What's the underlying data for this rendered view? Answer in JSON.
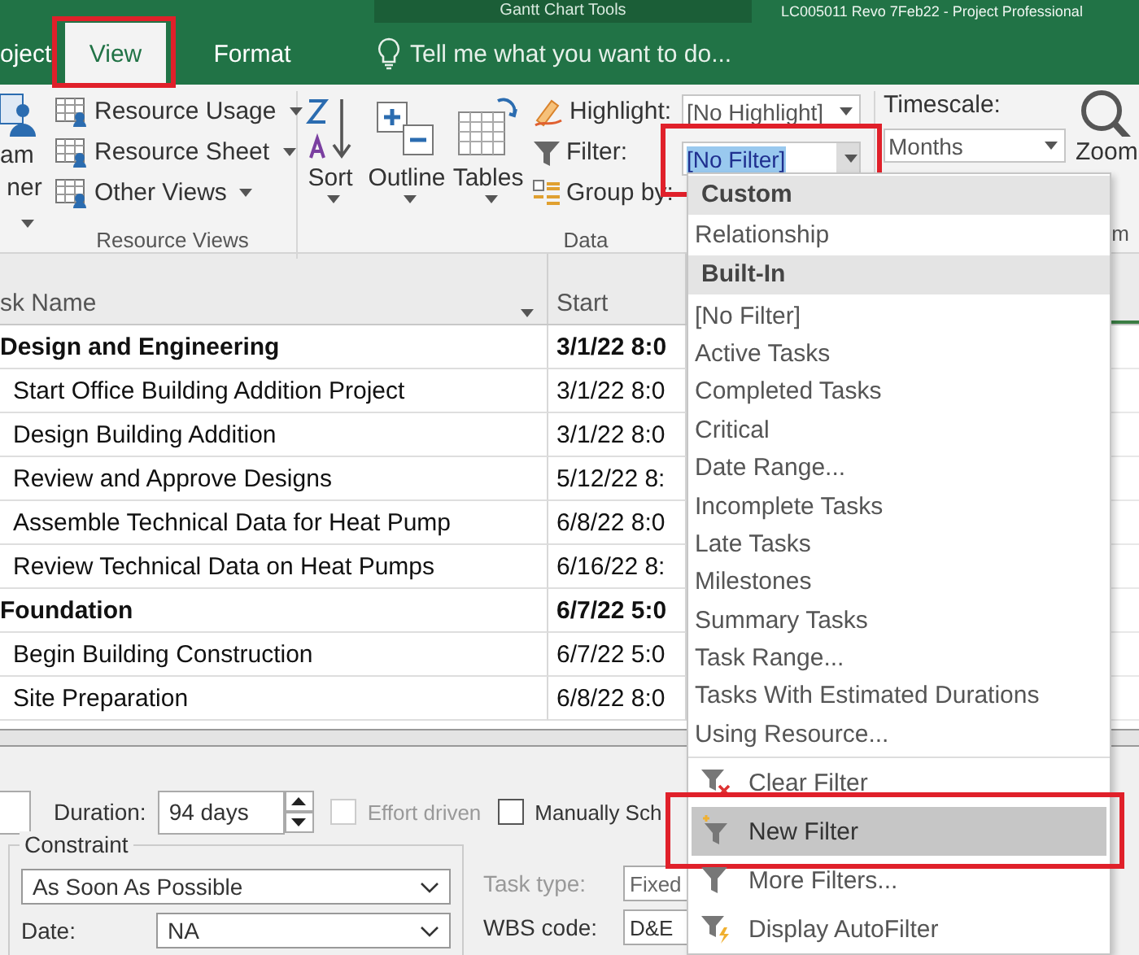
{
  "title_bar": {
    "context_label": "Gantt Chart Tools",
    "title": "LC005011 Revo 7Feb22 - Project Professional"
  },
  "tabs": [
    {
      "label": "oject",
      "selected": false,
      "highlighted": false
    },
    {
      "label": "View",
      "selected": true,
      "highlighted": true
    },
    {
      "label": "Format",
      "selected": false,
      "highlighted": false
    }
  ],
  "tell_me": {
    "placeholder": "Tell me what you want to do..."
  },
  "ribbon": {
    "team_planner": {
      "label_lines": [
        "am",
        "ner"
      ]
    },
    "resource_views": {
      "items": [
        {
          "label": "Resource Usage"
        },
        {
          "label": "Resource Sheet"
        },
        {
          "label": "Other Views"
        }
      ],
      "group_label": "Resource Views"
    },
    "data": {
      "buttons": [
        {
          "label": "Sort"
        },
        {
          "label": "Outline"
        },
        {
          "label": "Tables"
        }
      ],
      "highlight": {
        "label": "Highlight:",
        "value": "[No Highlight]"
      },
      "filter": {
        "label": "Filter:",
        "value": "[No Filter]",
        "highlighted": true
      },
      "group_by": {
        "label": "Group by:"
      },
      "group_label": "Data"
    },
    "zoom": {
      "timescale_label": "Timescale:",
      "timescale": "Months",
      "button": "Zoom",
      "group_label": "m"
    }
  },
  "table": {
    "columns": [
      "sk Name",
      "Start"
    ],
    "rows": [
      {
        "kind": "summary",
        "name": "Design and Engineering",
        "start": "3/1/22 8:0"
      },
      {
        "kind": "task",
        "name": "Start Office Building Addition Project",
        "start": "3/1/22 8:0"
      },
      {
        "kind": "task",
        "name": "Design Building Addition",
        "start": "3/1/22 8:0"
      },
      {
        "kind": "task",
        "name": "Review and Approve Designs",
        "start": "5/12/22 8:"
      },
      {
        "kind": "task",
        "name": "Assemble Technical Data for Heat Pump",
        "start": "6/8/22 8:0"
      },
      {
        "kind": "task",
        "name": "Review Technical Data on Heat Pumps",
        "start": "6/16/22 8:"
      },
      {
        "kind": "summary",
        "name": "Foundation",
        "start": "6/7/22 5:0"
      },
      {
        "kind": "task",
        "name": "Begin Building Construction",
        "start": "6/7/22 5:0"
      },
      {
        "kind": "task",
        "name": "Site Preparation",
        "start": "6/8/22 8:0"
      }
    ]
  },
  "task_form": {
    "duration_label": "Duration:",
    "duration": "94 days",
    "effort_driven": {
      "label": "Effort driven",
      "checked": false,
      "disabled": true
    },
    "manually_scheduled": {
      "label": "Manually Sch",
      "checked": false,
      "disabled": false
    },
    "constraint": {
      "label": "Constraint",
      "type": "As Soon As Possible",
      "date_label": "Date:",
      "date": "NA"
    },
    "task_type": {
      "label": "Task type:",
      "value": "Fixed",
      "disabled": true
    },
    "wbs_code": {
      "label": "WBS code:",
      "value": "D&E",
      "disabled": false
    }
  },
  "filter_menu": {
    "entries": [
      {
        "kind": "header",
        "label": "Custom"
      },
      {
        "kind": "item",
        "label": "Relationship",
        "selected": false
      },
      {
        "kind": "header",
        "label": "Built-In"
      },
      {
        "kind": "item",
        "label": "[No Filter]",
        "selected": false
      },
      {
        "kind": "item",
        "label": "Active Tasks",
        "selected": false
      },
      {
        "kind": "item",
        "label": "Completed Tasks",
        "selected": false
      },
      {
        "kind": "item",
        "label": "Critical",
        "selected": false
      },
      {
        "kind": "item",
        "label": "Date Range...",
        "selected": false
      },
      {
        "kind": "item",
        "label": "Incomplete Tasks",
        "selected": false
      },
      {
        "kind": "item",
        "label": "Late Tasks",
        "selected": false
      },
      {
        "kind": "item",
        "label": "Milestones",
        "selected": false
      },
      {
        "kind": "item",
        "label": "Summary Tasks",
        "selected": false
      },
      {
        "kind": "item",
        "label": "Task Range...",
        "selected": false
      },
      {
        "kind": "item",
        "label": "Tasks With Estimated Durations",
        "selected": false
      },
      {
        "kind": "item",
        "label": "Using Resource...",
        "selected": false
      },
      {
        "kind": "command",
        "label": "Clear Filter",
        "selected": false,
        "highlighted": false
      },
      {
        "kind": "command",
        "label": "New Filter",
        "selected": true,
        "highlighted": true
      },
      {
        "kind": "command",
        "label": "More Filters...",
        "selected": false,
        "highlighted": false
      },
      {
        "kind": "command",
        "label": "Display AutoFilter",
        "selected": false,
        "highlighted": false
      }
    ]
  }
}
